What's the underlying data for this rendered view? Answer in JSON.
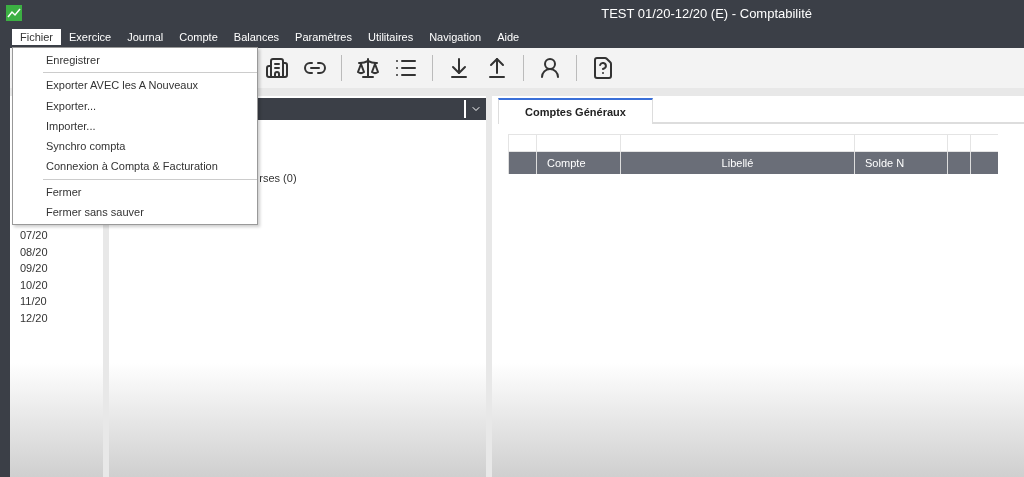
{
  "window": {
    "title": "TEST 01/20-12/20 (E) - Comptabilité"
  },
  "menu_bar": [
    {
      "label": "Fichier",
      "selected": true
    },
    {
      "label": "Exercice",
      "selected": false
    },
    {
      "label": "Journal",
      "selected": false
    },
    {
      "label": "Compte",
      "selected": false
    },
    {
      "label": "Balances",
      "selected": false
    },
    {
      "label": "Paramètres",
      "selected": false
    },
    {
      "label": "Utilitaires",
      "selected": false
    },
    {
      "label": "Navigation",
      "selected": false
    },
    {
      "label": "Aide",
      "selected": false
    }
  ],
  "file_menu": [
    {
      "kind": "item",
      "label": "Enregistrer"
    },
    {
      "kind": "separator"
    },
    {
      "kind": "item",
      "label": "Exporter AVEC les A Nouveaux"
    },
    {
      "kind": "item",
      "label": "Exporter..."
    },
    {
      "kind": "item",
      "label": "Importer..."
    },
    {
      "kind": "item",
      "label": "Synchro compta"
    },
    {
      "kind": "item",
      "label": "Connexion à Compta & Facturation"
    },
    {
      "kind": "separator"
    },
    {
      "kind": "item",
      "label": "Fermer"
    },
    {
      "kind": "item",
      "label": "Fermer sans sauver"
    }
  ],
  "periods": [
    "07/20",
    "08/20",
    "09/20",
    "10/20",
    "11/20",
    "12/20"
  ],
  "journal_panel": {
    "partial_item": "rses (0)"
  },
  "tabs": [
    {
      "label": "Comptes Généraux",
      "selected": true
    }
  ],
  "table": {
    "columns": [
      "",
      "Compte",
      "Libellé",
      "Solde N",
      "",
      ""
    ]
  }
}
